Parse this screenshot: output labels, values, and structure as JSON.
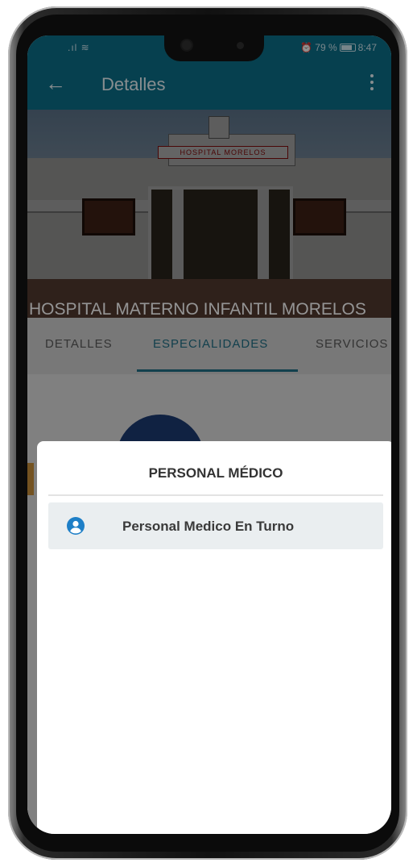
{
  "status_bar": {
    "signal": ".ıl ≋",
    "alarm": "⏰",
    "battery_text": "79 %",
    "time": "8:47"
  },
  "app_bar": {
    "back_icon": "arrow-left-icon",
    "title": "Detalles",
    "menu_icon": "more-vertical-icon"
  },
  "hero": {
    "sign_text": "HOSPITAL MORELOS",
    "title": "HOSPITAL MATERNO INFANTIL MORELOS"
  },
  "tabs": [
    {
      "label": "DETALLES",
      "selected": false
    },
    {
      "label": "ESPECIALIDADES",
      "selected": true
    },
    {
      "label": "SERVICIOS",
      "selected": false
    }
  ],
  "sheet": {
    "title": "PERSONAL MÉDICO",
    "items": [
      {
        "icon": "user-circle-icon",
        "label": "Personal Medico En Turno"
      }
    ]
  },
  "colors": {
    "primary": "#0c6f89",
    "accent": "#1f6f86",
    "icon_blue": "#1e7fc7"
  }
}
